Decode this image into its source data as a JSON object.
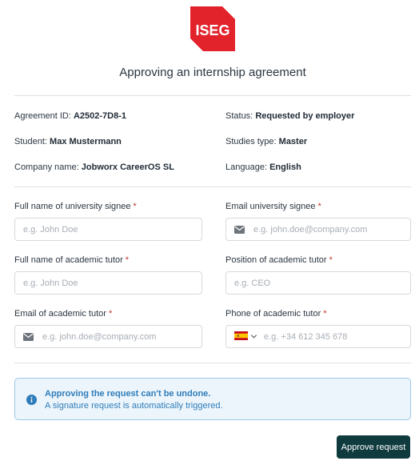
{
  "header": {
    "logo_text": "ISEG",
    "title": "Approving an internship agreement"
  },
  "info": {
    "agreement_id_label": "Agreement ID:",
    "agreement_id_value": "A2502-7D8-1",
    "status_label": "Status:",
    "status_value": "Requested by employer",
    "student_label": "Student:",
    "student_value": "Max Mustermann",
    "studies_type_label": "Studies type:",
    "studies_type_value": "Master",
    "company_label": "Company name:",
    "company_value": "Jobworx CareerOS SL",
    "language_label": "Language:",
    "language_value": "English"
  },
  "form": {
    "univ_signee_name": {
      "label": "Full name of university signee",
      "required": "*",
      "placeholder": "e.g. John Doe",
      "value": ""
    },
    "univ_signee_email": {
      "label": "Email university signee",
      "required": "*",
      "placeholder": "e.g. john.doe@company.com",
      "value": ""
    },
    "tutor_name": {
      "label": "Full name of academic tutor",
      "required": "*",
      "placeholder": "e.g. John Doe",
      "value": ""
    },
    "tutor_position": {
      "label": "Position of academic tutor",
      "required": "*",
      "placeholder": "e.g. CEO",
      "value": ""
    },
    "tutor_email": {
      "label": "Email of academic tutor",
      "required": "*",
      "placeholder": "e.g. john.doe@company.com",
      "value": ""
    },
    "tutor_phone": {
      "label": "Phone of academic tutor",
      "required": "*",
      "placeholder": "e.g. +34 612 345 678",
      "value": "",
      "country_flag": "spain-flag-icon"
    }
  },
  "alert": {
    "line1": "Approving the request can't be undone.",
    "line2": "A signature request is automatically triggered."
  },
  "actions": {
    "approve_label": "Approve request"
  },
  "colors": {
    "logo_red": "#e3232c",
    "button_bg": "#0f3b3f",
    "alert_bg": "#ecf5fb",
    "alert_text": "#2f7dba",
    "required": "#c0392b"
  }
}
